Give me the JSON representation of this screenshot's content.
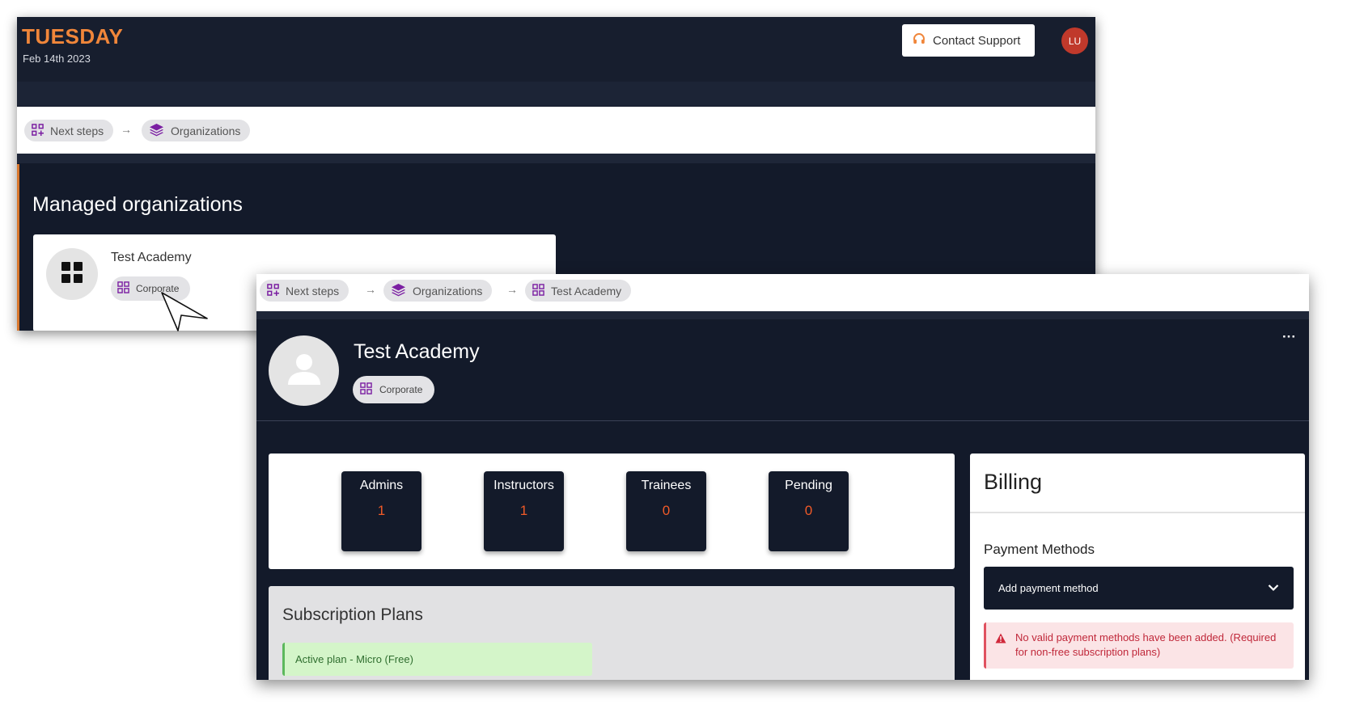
{
  "back_window": {
    "day": "TUESDAY",
    "date": "Feb 14th 2023",
    "support_label": "Contact Support",
    "avatar_initials": "LU",
    "breadcrumb": [
      {
        "label": "Next steps",
        "icon": "grid-plus-icon"
      },
      {
        "label": "Organizations",
        "icon": "layers-icon"
      }
    ],
    "page_title": "Managed organizations",
    "org_card": {
      "name": "Test Academy",
      "type_label": "Corporate",
      "icon": "apps-grid-icon"
    }
  },
  "front_window": {
    "breadcrumb": [
      {
        "label": "Next steps",
        "icon": "grid-plus-icon"
      },
      {
        "label": "Organizations",
        "icon": "layers-icon"
      },
      {
        "label": "Test Academy",
        "icon": "apps-grid-icon"
      }
    ],
    "org_name": "Test Academy",
    "type_label": "Corporate",
    "more_label": "···",
    "stats": [
      {
        "label": "Admins",
        "value": "1"
      },
      {
        "label": "Instructors",
        "value": "1"
      },
      {
        "label": "Trainees",
        "value": "0"
      },
      {
        "label": "Pending",
        "value": "0"
      }
    ],
    "subscription": {
      "title": "Subscription Plans",
      "active_plan": "Active plan - Micro (Free)"
    },
    "billing": {
      "title": "Billing",
      "payment_methods_title": "Payment Methods",
      "add_payment_label": "Add payment method",
      "alert_text": "No valid payment methods have been added. (Required for non-free subscription plans)"
    }
  },
  "colors": {
    "dark_bg": "#131a2a",
    "accent_orange": "#f0863a",
    "stat_value": "#f05a28",
    "icon_purple": "#7b1fa2",
    "avatar_red": "#c0392b"
  }
}
